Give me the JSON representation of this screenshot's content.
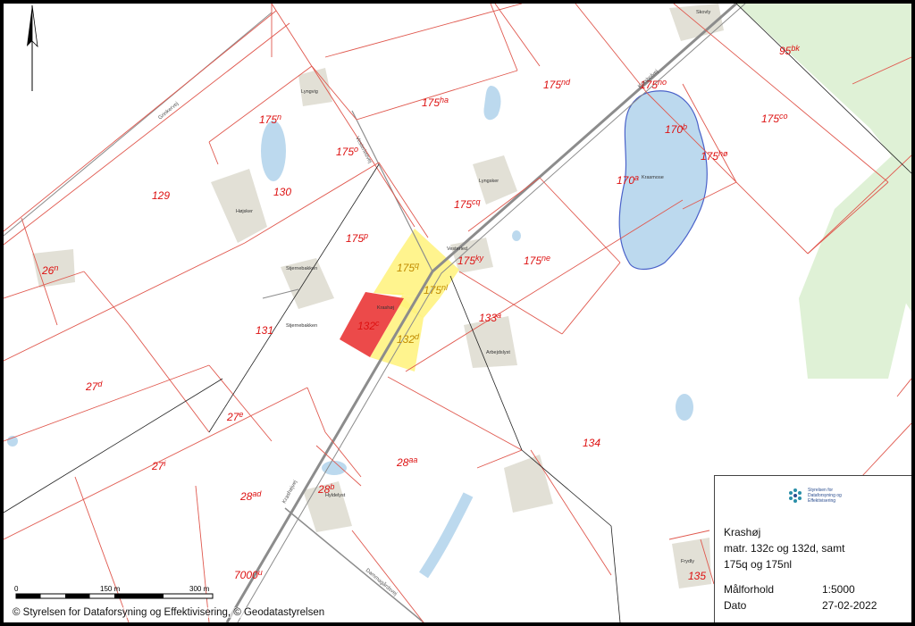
{
  "colors": {
    "boundary": "#e0584e",
    "water": "#bcd9ee",
    "forest": "#dff1d6",
    "building": "#e2e0d6",
    "highlight_red": "#ea3b3b",
    "highlight_yellow": "#fff27a"
  },
  "north_arrow": "north-arrow",
  "parcels": [
    {
      "base": "95",
      "sup": "bk"
    },
    {
      "base": "175",
      "sup": "no"
    },
    {
      "base": "175",
      "sup": "nd"
    },
    {
      "base": "175",
      "sup": "ha"
    },
    {
      "base": "175",
      "sup": "n"
    },
    {
      "base": "175",
      "sup": "co"
    },
    {
      "base": "170",
      "sup": "b"
    },
    {
      "base": "175",
      "sup": "hø"
    },
    {
      "base": "170",
      "sup": "a"
    },
    {
      "base": "175",
      "sup": "o"
    },
    {
      "base": "129",
      "sup": ""
    },
    {
      "base": "130",
      "sup": ""
    },
    {
      "base": "175",
      "sup": "cq"
    },
    {
      "base": "175",
      "sup": "p"
    },
    {
      "base": "175",
      "sup": "ky"
    },
    {
      "base": "175",
      "sup": "ne"
    },
    {
      "base": "26",
      "sup": "n"
    },
    {
      "base": "175",
      "sup": "q"
    },
    {
      "base": "175",
      "sup": "nl"
    },
    {
      "base": "132",
      "sup": "c"
    },
    {
      "base": "133",
      "sup": "a"
    },
    {
      "base": "131",
      "sup": ""
    },
    {
      "base": "132",
      "sup": "d"
    },
    {
      "base": "27",
      "sup": "d"
    },
    {
      "base": "27",
      "sup": "e"
    },
    {
      "base": "134",
      "sup": ""
    },
    {
      "base": "27",
      "sup": "i"
    },
    {
      "base": "28",
      "sup": "aa"
    },
    {
      "base": "28",
      "sup": "ad"
    },
    {
      "base": "28",
      "sup": "b"
    },
    {
      "base": "7000",
      "sup": "u"
    },
    {
      "base": "135",
      "sup": ""
    }
  ],
  "place_labels": [
    "Skovly",
    "Lyngvig",
    "Højsker",
    "Lyngsker",
    "Vesterled",
    "Stjernebakken",
    "Stjernebakken",
    "Krashøj",
    "Arbejdslyst",
    "Hyldelyst",
    "Krasmose",
    "Frydly"
  ],
  "road_labels": [
    "Grinkervej",
    "Vesterledvej",
    "Krashøjvej",
    "Krasbolvej",
    "Dammagårdsvej"
  ],
  "scale_bar": {
    "labels": [
      "0",
      "150 m",
      "300 m"
    ]
  },
  "copyright": "© Styrelsen for Dataforsyning og Effektivisering, © Geodatastyrelsen",
  "legend": {
    "logo_text": "Styrelsen for Dataforsyning og Effektivisering",
    "title": "Krashøj",
    "line1": "matr. 132c og 132d, samt",
    "line2": "175q og 175nl",
    "scale_label": "Målforhold",
    "scale_value": "1:5000",
    "date_label": "Dato",
    "date_value": "27-02-2022"
  }
}
